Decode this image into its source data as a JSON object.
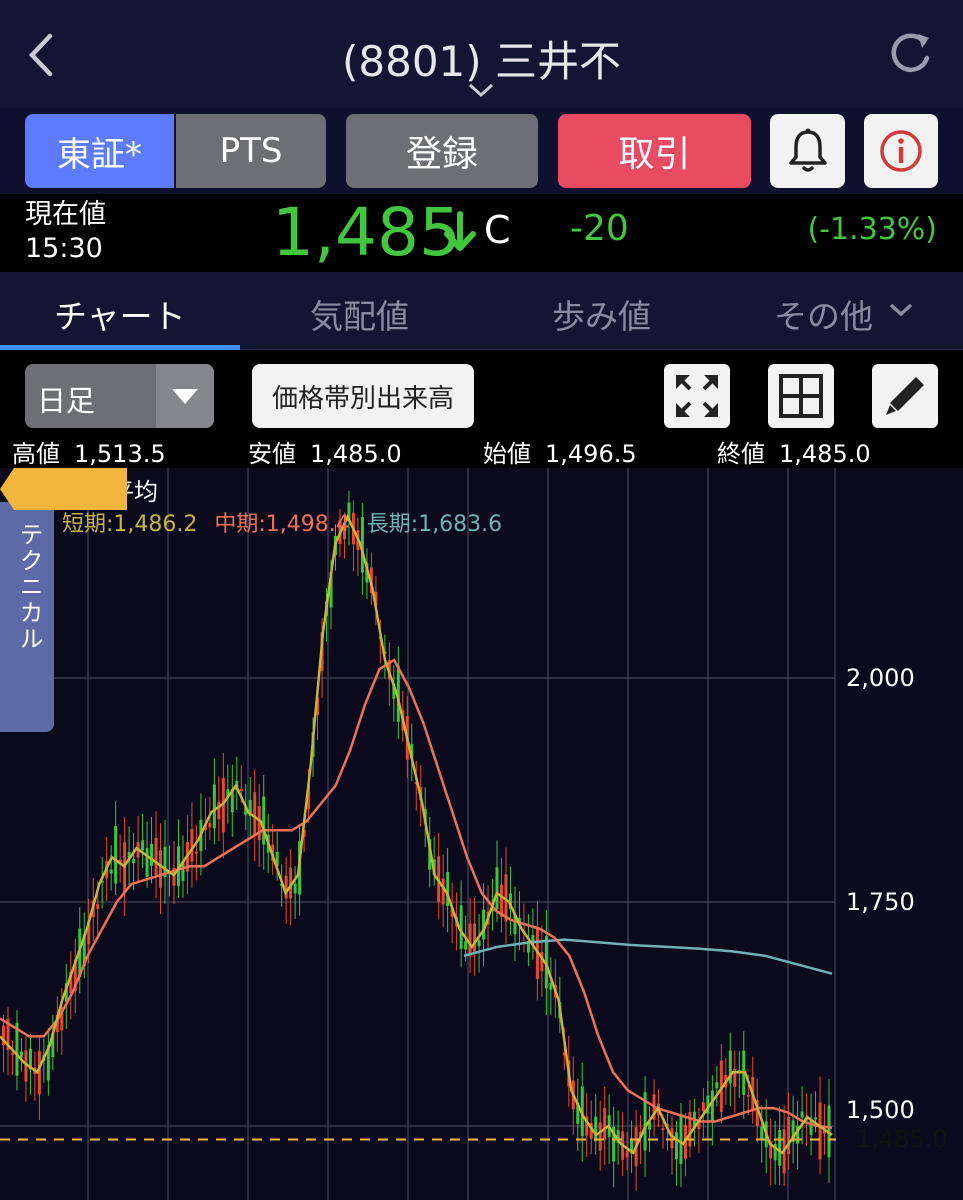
{
  "header": {
    "title": "(8801) 三井不"
  },
  "buttons": {
    "tse": "東証*",
    "pts": "PTS",
    "register": "登録",
    "trade": "取引"
  },
  "quote": {
    "label": "現在値",
    "time": "15:30",
    "price": "1,485",
    "flag": "C",
    "change": "-20",
    "change_pct": "(-1.33%)",
    "up_color": "#41c63e"
  },
  "tabs": [
    "チャート",
    "気配値",
    "歩み値",
    "その他"
  ],
  "toolbar": {
    "period": "日足",
    "volume_button": "価格帯別出来高"
  },
  "ohlc": {
    "high_label": "高値",
    "high": "1,513.5",
    "low_label": "安値",
    "low": "1,485.0",
    "open_label": "始値",
    "open": "1,496.5",
    "close_label": "終値",
    "close": "1,485.0"
  },
  "technical_tab": "テクニカル",
  "moving_average": {
    "title": "移動平均",
    "short": "短期:1,486.2",
    "mid": "中期:1,498.4",
    "long": "長期:1,683.6"
  },
  "chart_data": {
    "type": "line",
    "ticks": [
      "2,000",
      "1,750",
      "1,500"
    ],
    "tick_values": [
      2000,
      1750,
      1500
    ],
    "current_price_tag": "1,485.0",
    "current_price": 1485.0,
    "colors": {
      "up": "#35c83a",
      "down": "#e8492c",
      "short_ma": "#c7b43e",
      "mid_ma": "#ee7057",
      "long_ma": "#6fb2b7"
    },
    "short_ma": [
      1600,
      1585,
      1570,
      1560,
      1590,
      1640,
      1680,
      1720,
      1770,
      1800,
      1790,
      1810,
      1800,
      1790,
      1780,
      1800,
      1820,
      1850,
      1860,
      1880,
      1850,
      1840,
      1800,
      1760,
      1780,
      1900,
      2050,
      2150,
      2180,
      2150,
      2100,
      2020,
      1980,
      1920,
      1860,
      1780,
      1760,
      1720,
      1700,
      1720,
      1760,
      1750,
      1720,
      1700,
      1680,
      1640,
      1540,
      1510,
      1490,
      1500,
      1480,
      1470,
      1500,
      1520,
      1490,
      1480,
      1500,
      1520,
      1540,
      1560,
      1560,
      1520,
      1480,
      1470,
      1490,
      1510,
      1500,
      1490
    ],
    "mid_ma": [
      1620,
      1610,
      1600,
      1600,
      1620,
      1650,
      1690,
      1720,
      1750,
      1770,
      1775,
      1780,
      1785,
      1790,
      1790,
      1800,
      1810,
      1820,
      1830,
      1830,
      1830,
      1840,
      1860,
      1880,
      1920,
      1970,
      2010,
      2020,
      1990,
      1950,
      1900,
      1850,
      1800,
      1760,
      1740,
      1730,
      1725,
      1720,
      1710,
      1690,
      1650,
      1600,
      1560,
      1540,
      1530,
      1520,
      1515,
      1510,
      1505,
      1505,
      1510,
      1515,
      1520,
      1520,
      1515,
      1505,
      1500,
      1498
    ],
    "long_ma": [
      1690,
      1700,
      1705,
      1708,
      1705,
      1702,
      1700,
      1698,
      1695,
      1690,
      1680,
      1670
    ]
  }
}
